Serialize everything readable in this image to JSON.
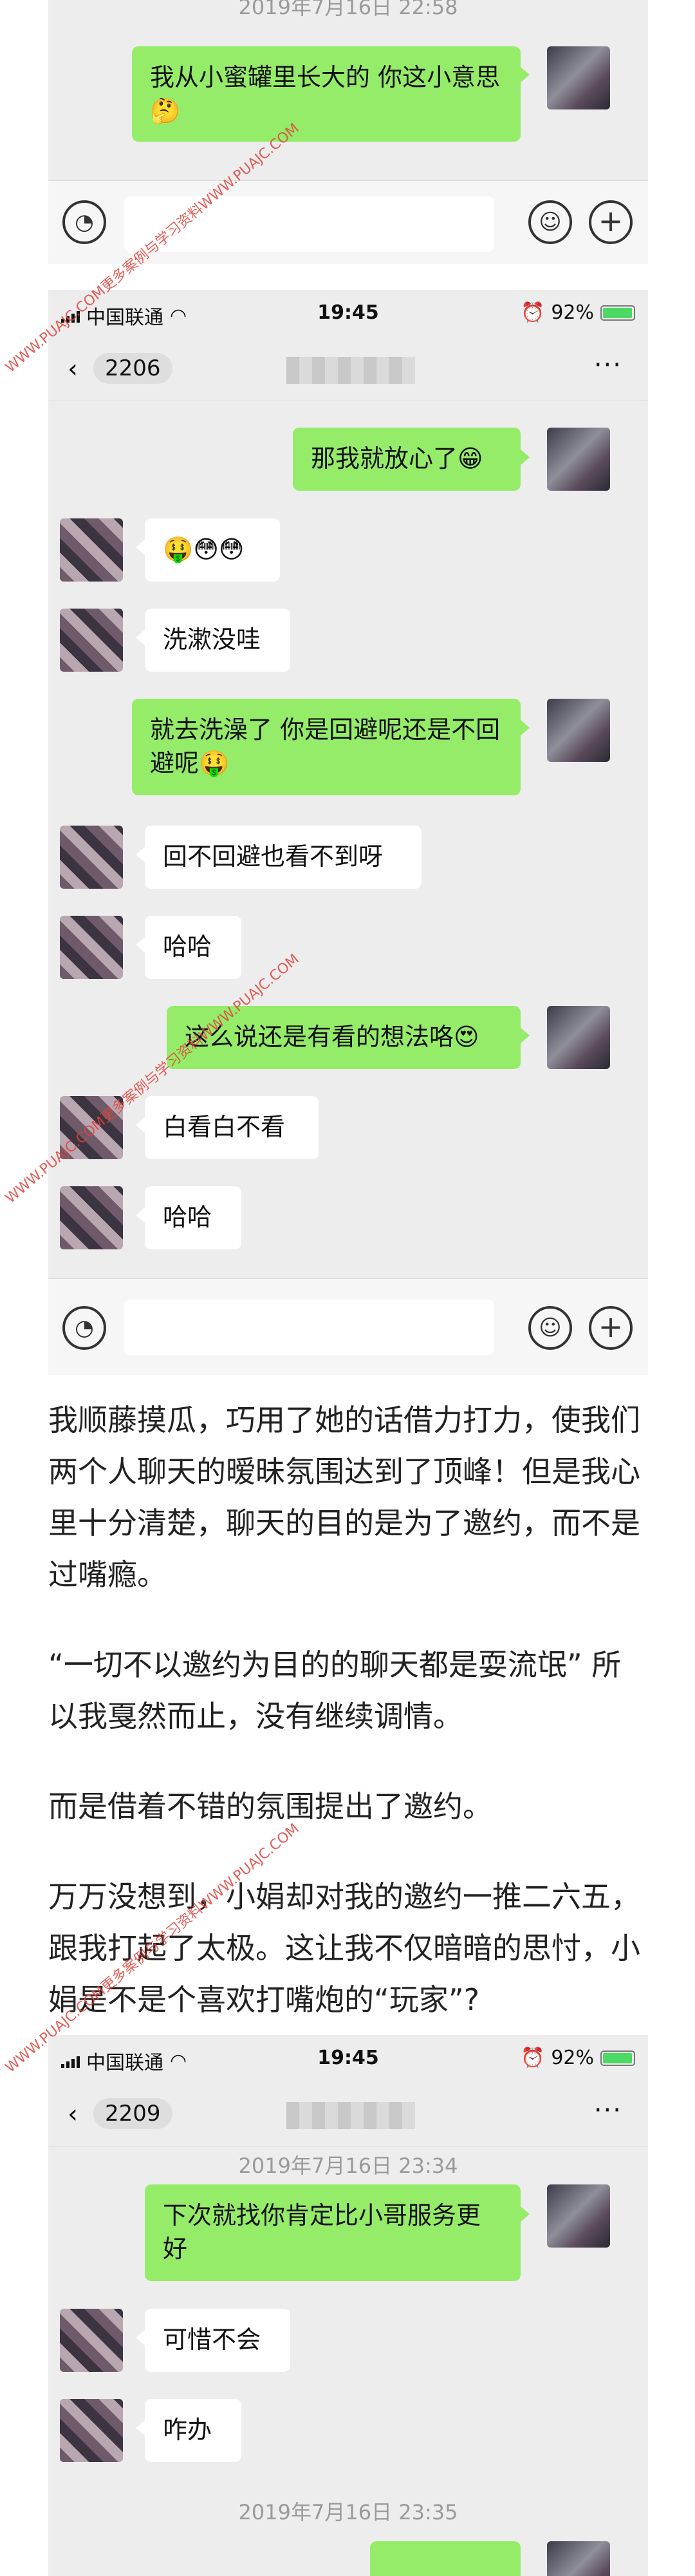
{
  "screens": [
    {
      "top_timestamp": "2019年7月16日 22:58",
      "messages": [
        {
          "side": "me",
          "text": "我从小蜜罐里长大的 你这小意思 🤔"
        }
      ]
    },
    {
      "status": {
        "carrier": "中国联通",
        "time": "19:45",
        "battery": "92%",
        "battery_level": 0.92
      },
      "nav": {
        "back_count": "2206"
      },
      "messages": [
        {
          "side": "me",
          "text": "那我就放心了😁"
        },
        {
          "side": "other",
          "text": "🤑😳😳"
        },
        {
          "side": "other",
          "text": "洗漱没哇"
        },
        {
          "side": "me",
          "text": "就去洗澡了 你是回避呢还是不回避呢🤑"
        },
        {
          "side": "other",
          "text": "回不回避也看不到呀"
        },
        {
          "side": "other",
          "text": "哈哈"
        },
        {
          "side": "me",
          "text": "这么说还是有看的想法咯😍"
        },
        {
          "side": "other",
          "text": "白看白不看"
        },
        {
          "side": "other",
          "text": "哈哈"
        }
      ]
    },
    {
      "status": {
        "carrier": "中国联通",
        "time": "19:45",
        "battery": "92%",
        "battery_level": 0.92
      },
      "nav": {
        "back_count": "2209"
      },
      "timestamp1": "2019年7月16日 23:34",
      "timestamp2": "2019年7月16日 23:35",
      "messages": [
        {
          "side": "me",
          "text": "下次就找你肯定比小哥服务更好"
        },
        {
          "side": "other",
          "text": "可惜不会"
        },
        {
          "side": "other",
          "text": "咋办"
        }
      ]
    }
  ],
  "article": {
    "p1": "我顺藤摸瓜，巧用了她的话借力打力，使我们两个人聊天的暧昧氛围达到了顶峰！但是我心里十分清楚，聊天的目的是为了邀约，而不是过嘴瘾。",
    "p2": "“一切不以邀约为目的的聊天都是耍流氓” 所以我戛然而止，没有继续调情。",
    "p3": "而是借着不错的氛围提出了邀约。",
    "p4": " 万万没想到，小娟却对我的邀约一推二六五，跟我打起了太极。这让我不仅暗暗的思忖，小娟是不是个喜欢打嘴炮的“玩家”?"
  },
  "watermark": "WWW.PUAJC.COM更多案例与学习资料WWW.PUAJC.COM"
}
